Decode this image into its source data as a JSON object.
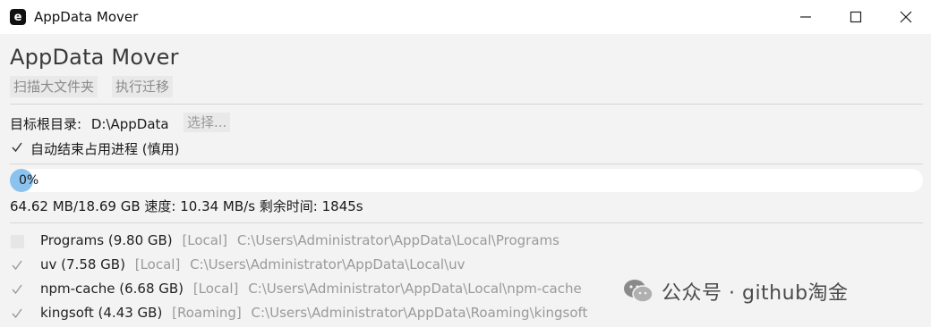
{
  "window": {
    "icon_letter": "e",
    "title": "AppData Mover",
    "minimize_icon": "minimize-icon",
    "maximize_icon": "maximize-icon",
    "close_icon": "close-icon"
  },
  "header": {
    "title": "AppData Mover",
    "scan_button": "扫描大文件夹",
    "migrate_button": "执行迁移"
  },
  "settings": {
    "target_label": "目标根目录:",
    "target_value": "D:\\AppData",
    "browse_button": "选择...",
    "auto_kill_label": "自动结束占用进程 (慎用)",
    "auto_kill_checked": true
  },
  "progress": {
    "percent_label": "0%",
    "value": 0.0035,
    "stats": "64.62 MB/18.69 GB  速度: 10.34 MB/s  剩余时间: 1845s"
  },
  "folders": [
    {
      "name": "Programs (9.80 GB)",
      "location": "[Local]",
      "path": "C:\\Users\\Administrator\\AppData\\Local\\Programs",
      "checked": false
    },
    {
      "name": "uv (7.58 GB)",
      "location": "[Local]",
      "path": "C:\\Users\\Administrator\\AppData\\Local\\uv",
      "checked": true
    },
    {
      "name": "npm-cache (6.68 GB)",
      "location": "[Local]",
      "path": "C:\\Users\\Administrator\\AppData\\Local\\npm-cache",
      "checked": true
    },
    {
      "name": "kingsoft (4.43 GB)",
      "location": "[Roaming]",
      "path": "C:\\Users\\Administrator\\AppData\\Roaming\\kingsoft",
      "checked": true
    }
  ],
  "watermark": {
    "icon": "wechat-icon",
    "text": "公众号 · github淘金"
  },
  "colors": {
    "progress_fill": "#8cc3ee",
    "background": "#f3f3f3",
    "disabled_text": "#9a9a9a"
  }
}
